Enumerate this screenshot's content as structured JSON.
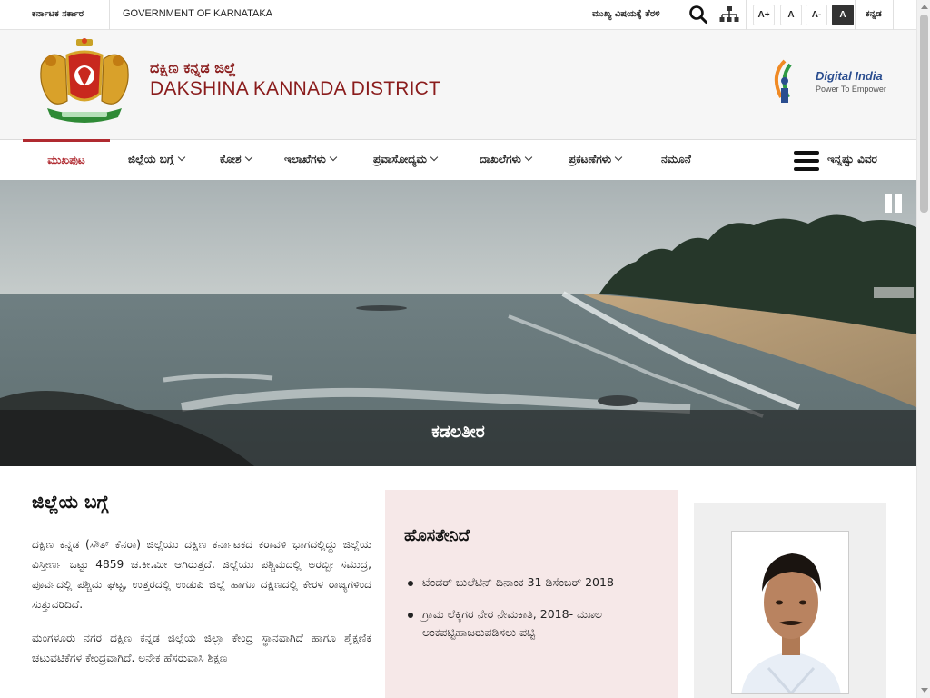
{
  "topbar": {
    "gov_kannada": "ಕರ್ನಾಟಕ ಸರ್ಕಾರ",
    "gov_english": "GOVERNMENT OF KARNATAKA",
    "skip_link": "ಮುಖ್ಯ ವಿಷಯಕ್ಕೆ ತೆರಳಿ",
    "search_icon": "search-icon",
    "sitemap_icon": "sitemap-icon",
    "font_increase": "A+",
    "font_normal": "A",
    "font_decrease": "A-",
    "high_contrast": "A",
    "language": "ಕನ್ನಡ"
  },
  "header": {
    "title_kannada": "ದಕ್ಷಿಣ ಕನ್ನಡ ಜಿಲ್ಲೆ",
    "title_english": "DAKSHINA KANNADA DISTRICT",
    "digital_india_title": "Digital India",
    "digital_india_sub": "Power To Empower"
  },
  "nav": {
    "home": "ಮುಖಪುಟ",
    "items": [
      "ಜಿಲ್ಲೆಯ ಬಗ್ಗೆ",
      "ಕೋಶ",
      "ಇಲಾಖೆಗಳು",
      "ಪ್ರವಾಸೋದ್ಯಮ",
      "ದಾಖಲೆಗಳು",
      "ಪ್ರಕಟಣೆಗಳು"
    ],
    "last": "ನಮೂನೆ",
    "more": "ಇನ್ನಷ್ಟು ವಿವರ"
  },
  "hero": {
    "caption": "ಕಡಲತೀರ"
  },
  "about": {
    "title": "ಜಿಲ್ಲೆಯ ಬಗ್ಗೆ",
    "para1": "ದಕ್ಷಿಣ ಕನ್ನಡ (ಸೌತ್ ಕೆನರಾ) ಜಿಲ್ಲೆಯು ದಕ್ಷಿಣ ಕರ್ನಾಟಕದ ಕರಾವಳಿ ಭಾಗದಲ್ಲಿದ್ದು ಜಿಲ್ಲೆಯ ವಿಸ್ತೀರ್ಣ ಒಟ್ಟು 4859 ಚ.ಕೀ.ಮೀ ಆಗಿರುತ್ತದೆ. ಜಿಲ್ಲೆಯು ಪಶ್ಚಿಮದಲ್ಲಿ ಅರಬ್ಬೀ ಸಮುದ್ರ, ಪೂರ್ವದಲ್ಲಿ ಪಶ್ಚಿಮ ಘಟ್ಟ, ಉತ್ತರದಲ್ಲಿ ಉಡುಪಿ ಜಿಲ್ಲೆ ಹಾಗೂ ದಕ್ಷಿಣದಲ್ಲಿ ಕೇರಳ ರಾಜ್ಯಗಳಿಂದ ಸುತ್ತುವರಿದಿದೆ.",
    "para2": "ಮಂಗಳೂರು ನಗರ ದಕ್ಷಿಣ ಕನ್ನಡ ಜಿಲ್ಲೆಯ ಜಿಲ್ಲಾ ಕೇಂದ್ರ ಸ್ಥಾನವಾಗಿದೆ ಹಾಗೂ ಶೈಕ್ಷಣಿಕ ಚಟುವಟಿಕೆಗಳ ಕೇಂದ್ರವಾಗಿದೆ. ಅನೇಕ ಹೆಸರುವಾಸಿ ಶಿಕ್ಷಣ"
  },
  "news": {
    "title": "ಹೊಸತೇನಿದೆ",
    "items": [
      "ಟೆಂಡರ್ ಬುಲೆಟಿನ್ ದಿನಾಂಕ 31 ಡಿಸೆಂಬರ್ 2018",
      "ಗ್ರಾಮ ಲೆಕ್ಕಿಗರ ನೇರ ನೇಮಕಾತಿ, 2018- ಮೂಲ ಅಂಕಪಟ್ಟಿಹಾಜರುಪಡಿಸಲು ಪಟ್ಟಿ"
    ]
  },
  "colors": {
    "brand_red": "#8a1c1c",
    "nav_active": "#b02a30",
    "news_bg": "#f6e8e8"
  }
}
